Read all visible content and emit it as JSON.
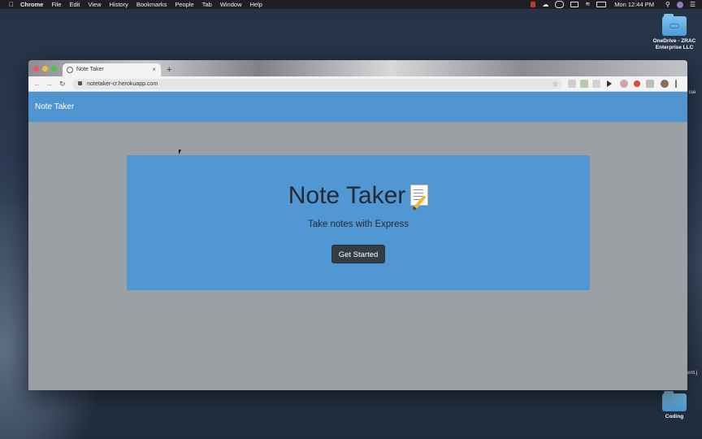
{
  "menubar": {
    "app": "Chrome",
    "items": [
      "File",
      "Edit",
      "View",
      "History",
      "Bookmarks",
      "People",
      "Tab",
      "Window",
      "Help"
    ],
    "clock": "Mon 12:44 PM"
  },
  "desktop": {
    "onedrive_label_line1": "OneDrive - ZRAC",
    "onedrive_label_line2": "Enterprise LLC",
    "coding_label": "Coding",
    "edge_text_1": "ise",
    "edge_text_2": "ent.j"
  },
  "browser": {
    "tab_title": "Note Taker",
    "tab_close": "×",
    "new_tab": "+",
    "url": "notetaker-cr.herokuapp.com"
  },
  "page": {
    "brand": "Note Taker",
    "hero_title": "Note Taker",
    "hero_subtitle": "Take notes with Express",
    "cta_label": "Get Started"
  },
  "colors": {
    "navbar": "#5094d0",
    "jumbotron": "#5197d3",
    "page_bg": "#9aa0a3",
    "button": "#343c45"
  }
}
